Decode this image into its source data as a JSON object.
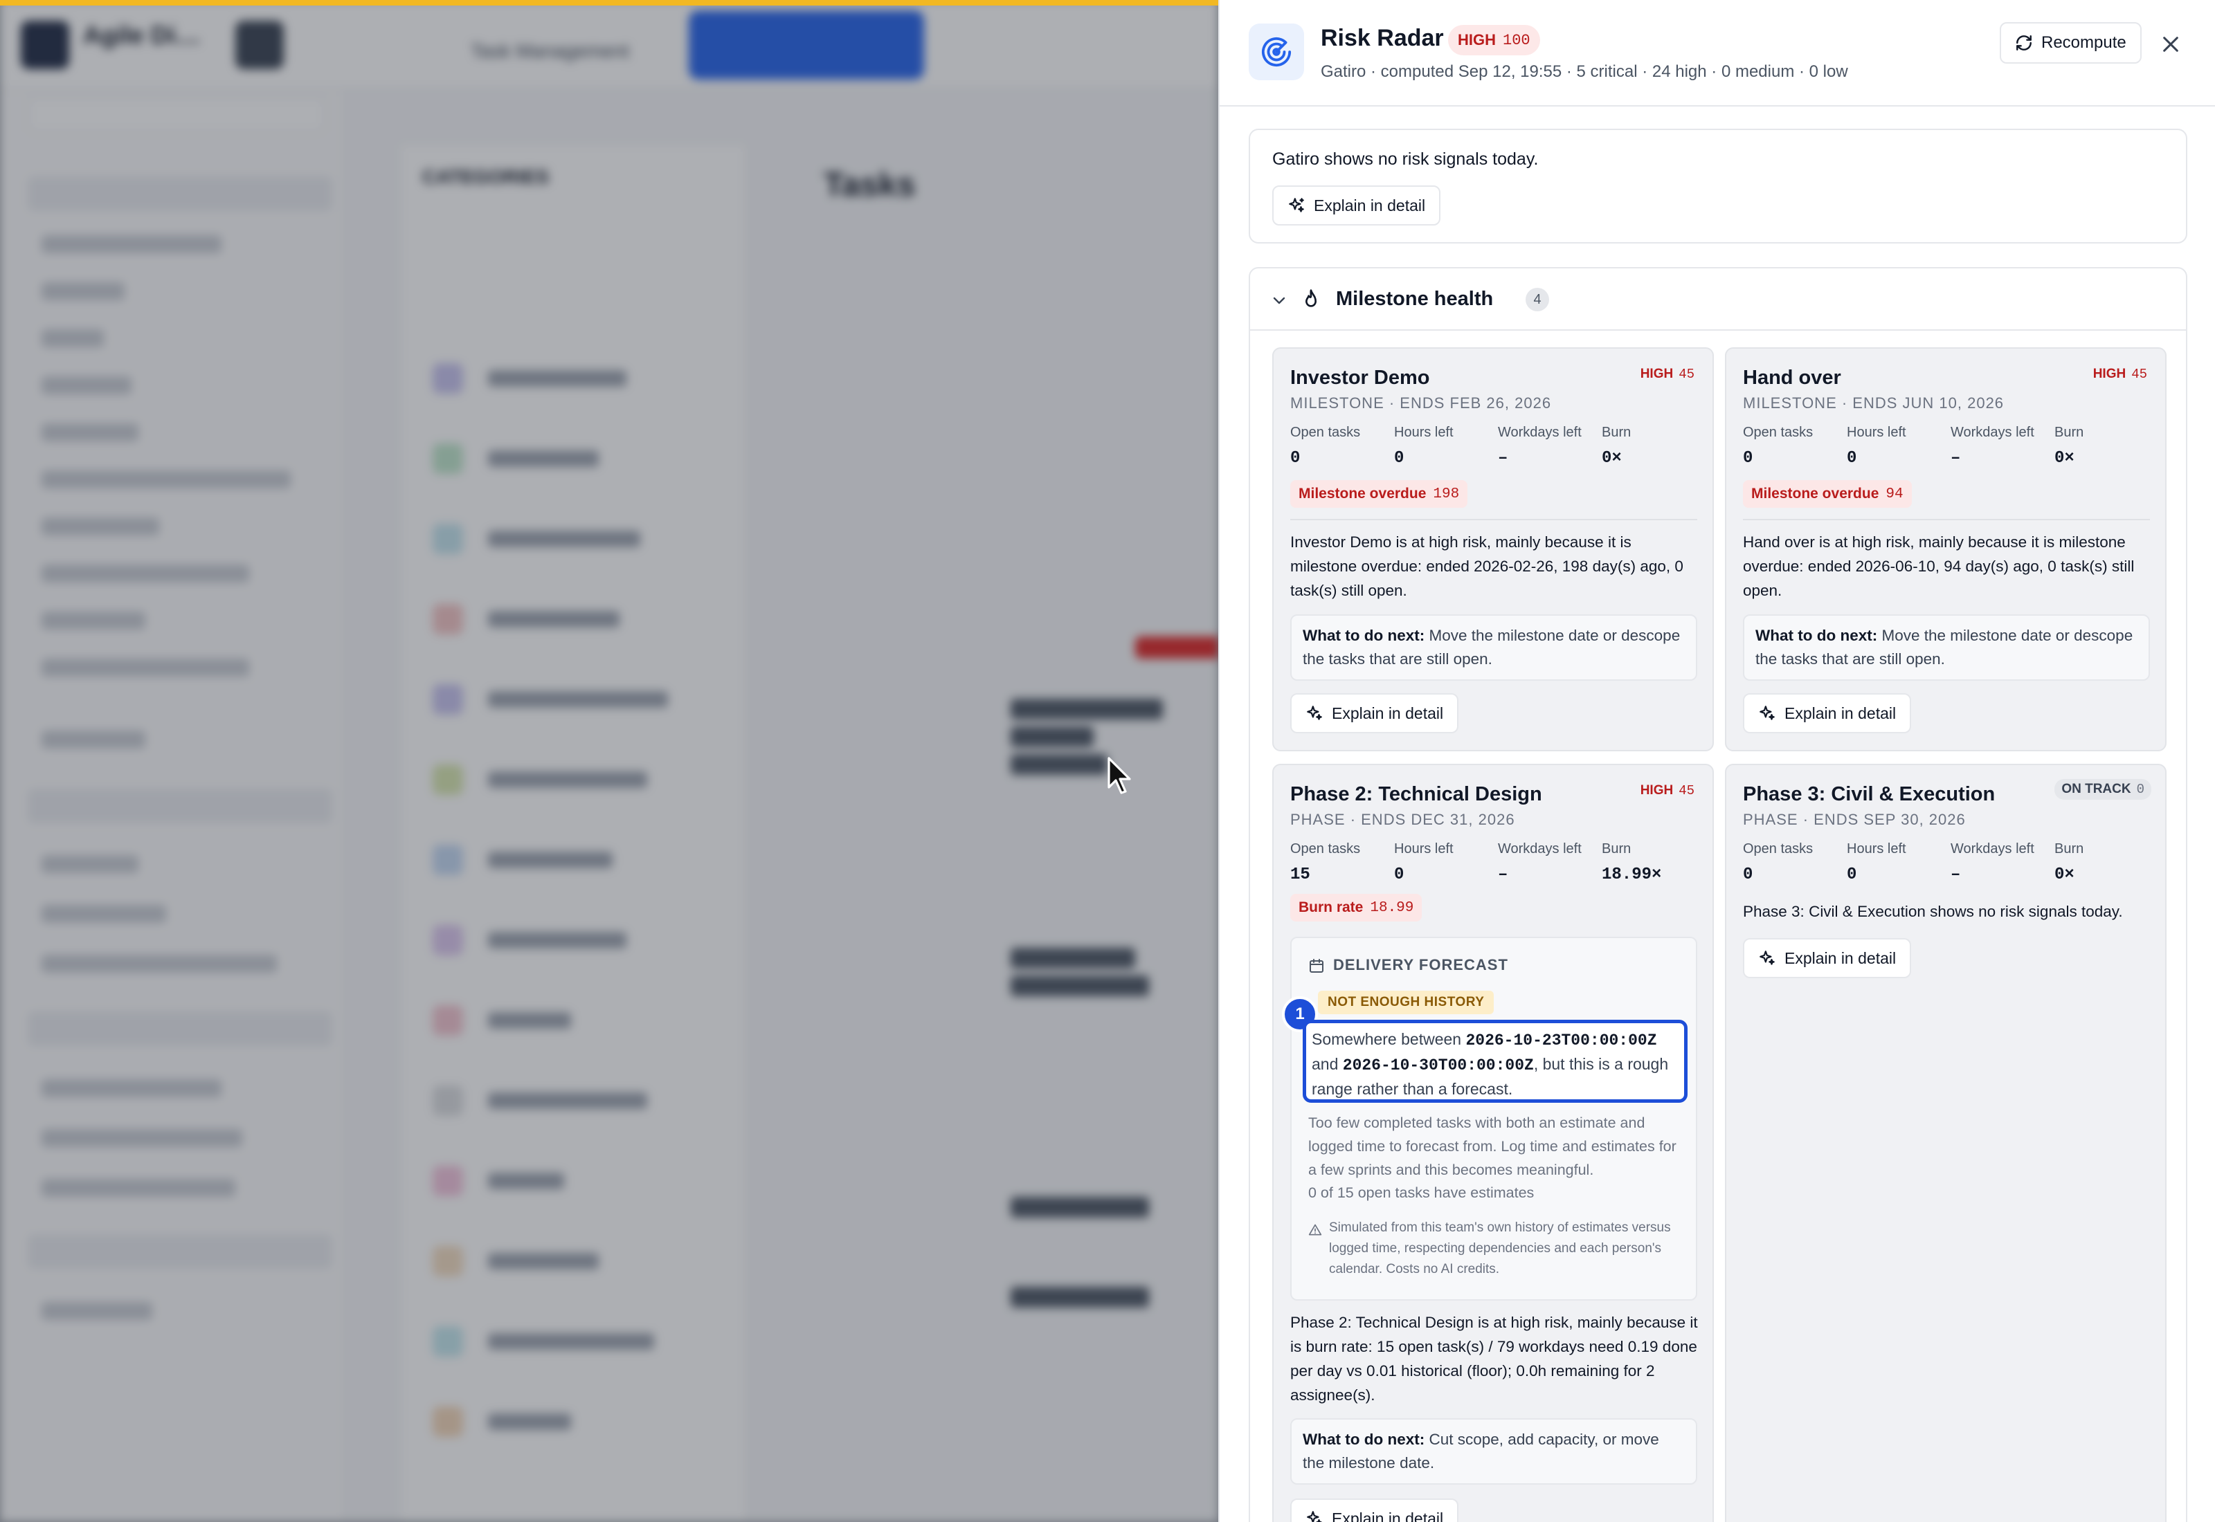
{
  "background": {
    "app_name": "Agile Di…",
    "breadcrumb": "Task Management",
    "categories_title": "CATEGORIES",
    "tasks_title": "Tasks"
  },
  "drawer": {
    "title": "Risk Radar",
    "risk_level": "HIGH",
    "risk_score": "100",
    "subtitle": "Gatiro · computed Sep 12, 19:55 · 5 critical · 24 high · 0 medium · 0 low",
    "recompute_label": "Recompute",
    "summary": {
      "text": "Gatiro shows no risk signals today.",
      "explain_label": "Explain in detail"
    },
    "milestone_health": {
      "title": "Milestone health",
      "count": "4",
      "stat_labels": [
        "Open tasks",
        "Hours left",
        "Workdays left",
        "Burn"
      ],
      "cards": [
        {
          "name": "Investor Demo",
          "meta": "MILESTONE · ENDS FEB 26, 2026",
          "badge_label": "HIGH",
          "badge_score": "45",
          "stats": [
            "0",
            "0",
            "–",
            "0×"
          ],
          "signal_label": "Milestone overdue",
          "signal_value": "198",
          "description": "Investor Demo is at high risk, mainly because it is milestone overdue: ended 2026-02-26, 198 day(s) ago, 0 task(s) still open.",
          "next_label": "What to do next:",
          "next_text": "Move the milestone date or descope the tasks that are still open.",
          "explain_label": "Explain in detail"
        },
        {
          "name": "Hand over",
          "meta": "MILESTONE · ENDS JUN 10, 2026",
          "badge_label": "HIGH",
          "badge_score": "45",
          "stats": [
            "0",
            "0",
            "–",
            "0×"
          ],
          "signal_label": "Milestone overdue",
          "signal_value": "94",
          "description": "Hand over is at high risk, mainly because it is milestone overdue: ended 2026-06-10, 94 day(s) ago, 0 task(s) still open.",
          "next_label": "What to do next:",
          "next_text": "Move the milestone date or descope the tasks that are still open.",
          "explain_label": "Explain in detail"
        },
        {
          "name": "Phase 2: Technical Design",
          "meta": "PHASE · ENDS DEC 31, 2026",
          "badge_label": "HIGH",
          "badge_score": "45",
          "stats": [
            "15",
            "0",
            "–",
            "18.99×"
          ],
          "signal_label": "Burn rate",
          "signal_value": "18.99",
          "forecast": {
            "title": "DELIVERY FORECAST",
            "tag": "NOT ENOUGH HISTORY",
            "step": "1",
            "range_prefix": "Somewhere between",
            "range_start": "2026-10-23T00:00:00Z",
            "range_and": "and",
            "range_end": "2026-10-30T00:00:00Z",
            "range_suffix": ", but this is a rough range rather than a forecast.",
            "note": "Too few completed tasks with both an estimate and logged time to forecast from. Log time and estimates for a few sprints and this becomes meaningful.",
            "estimate_count": "0 of 15 open tasks have estimates",
            "simulation_note": "Simulated from this team's own history of estimates versus logged time, respecting dependencies and each person's calendar. Costs no AI credits."
          },
          "description": "Phase 2: Technical Design is at high risk, mainly because it is burn rate: 15 open task(s) / 79 workdays need 0.19 done per day vs 0.01 historical (floor); 0.0h remaining for 2 assignee(s).",
          "next_label": "What to do next:",
          "next_text": "Cut scope, add capacity, or move the milestone date.",
          "explain_label": "Explain in detail"
        },
        {
          "name": "Phase 3: Civil & Execution",
          "meta": "PHASE · ENDS SEP 30, 2026",
          "badge_label": "ON TRACK",
          "badge_score": "0",
          "stats": [
            "0",
            "0",
            "–",
            "0×"
          ],
          "description": "Phase 3: Civil & Execution shows no risk signals today.",
          "explain_label": "Explain in detail"
        }
      ]
    }
  },
  "colors": {
    "accent": "#1d4ed8",
    "danger": "#b91c1c",
    "warning_bg": "#fdeec9",
    "top_accent": "#f2b823"
  }
}
